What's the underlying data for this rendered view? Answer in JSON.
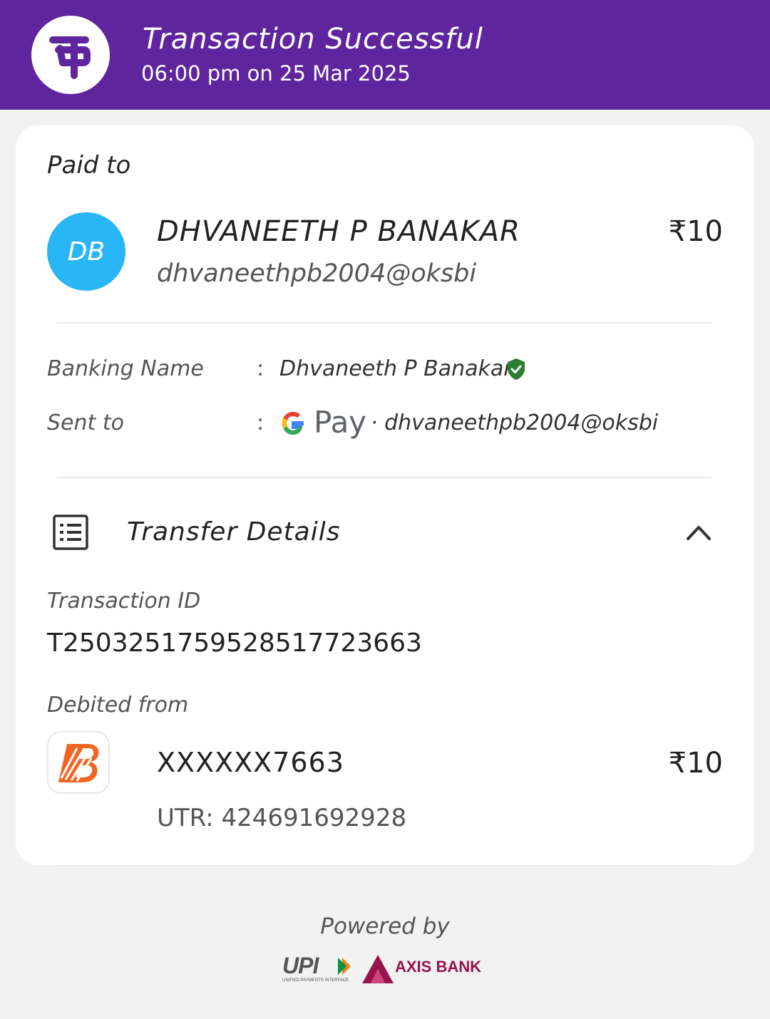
{
  "header": {
    "title": "Transaction Successful",
    "subtitle": "06:00 pm on 25 Mar 2025",
    "brand_color": "#5f259f"
  },
  "paid_to": {
    "label": "Paid to",
    "avatar_initials": "DB",
    "avatar_color": "#29b6f6",
    "name": "DHVANEETH P  BANAKAR",
    "vpa": "dhvaneethpb2004@oksbi",
    "amount": "₹10"
  },
  "details": {
    "banking_name_label": "Banking Name",
    "banking_name_value": "Dhvaneeth P  Banakar",
    "sent_to_label": "Sent to",
    "sent_to_app": "Pay",
    "sent_to_vpa": "· dhvaneethpb2004@oksbi",
    "colon": ":"
  },
  "transfer": {
    "section_title": "Transfer Details",
    "txn_label": "Transaction ID",
    "txn_id": "T2503251759528517723663",
    "debited_label": "Debited from",
    "account": "XXXXXX7663",
    "amount": "₹10",
    "utr": "UTR: 424691692928"
  },
  "footer": {
    "powered_by": "Powered by",
    "upi_label": "UPI",
    "upi_tagline": "UNIFIED PAYMENTS INTERFACE",
    "bank_label": "AXIS BANK"
  }
}
